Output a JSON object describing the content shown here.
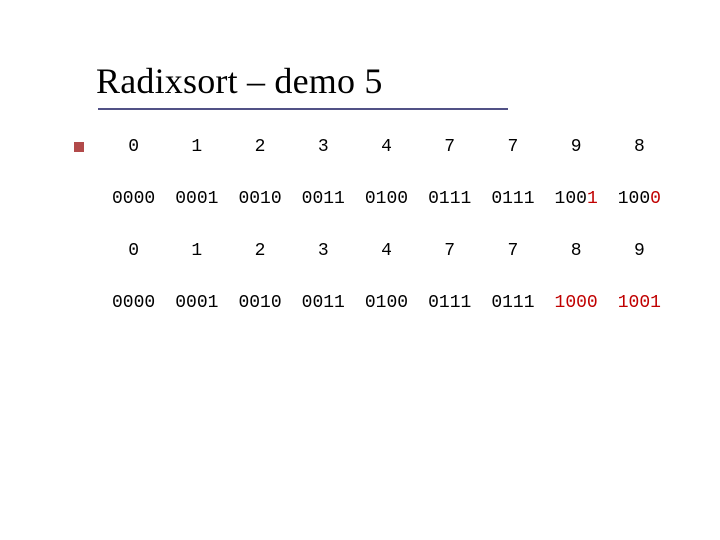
{
  "title": "Radixsort – demo 5",
  "rows": {
    "dec1": [
      "0",
      "1",
      "2",
      "3",
      "4",
      "7",
      "7",
      "9",
      "8"
    ],
    "bin1": [
      {
        "plain": "0000"
      },
      {
        "plain": "0001"
      },
      {
        "plain": "0010"
      },
      {
        "plain": "0011"
      },
      {
        "plain": "0100"
      },
      {
        "plain": "0111"
      },
      {
        "plain": "0111"
      },
      {
        "prefix": "100",
        "hl": "1"
      },
      {
        "prefix": "100",
        "hl": "0"
      }
    ],
    "dec2": [
      "0",
      "1",
      "2",
      "3",
      "4",
      "7",
      "7",
      "8",
      "9"
    ],
    "bin2": [
      {
        "plain": "0000"
      },
      {
        "plain": "0001"
      },
      {
        "plain": "0010"
      },
      {
        "plain": "0011"
      },
      {
        "plain": "0100"
      },
      {
        "plain": "0111"
      },
      {
        "plain": "0111"
      },
      {
        "hl": "1000"
      },
      {
        "hl": "1001"
      }
    ]
  }
}
